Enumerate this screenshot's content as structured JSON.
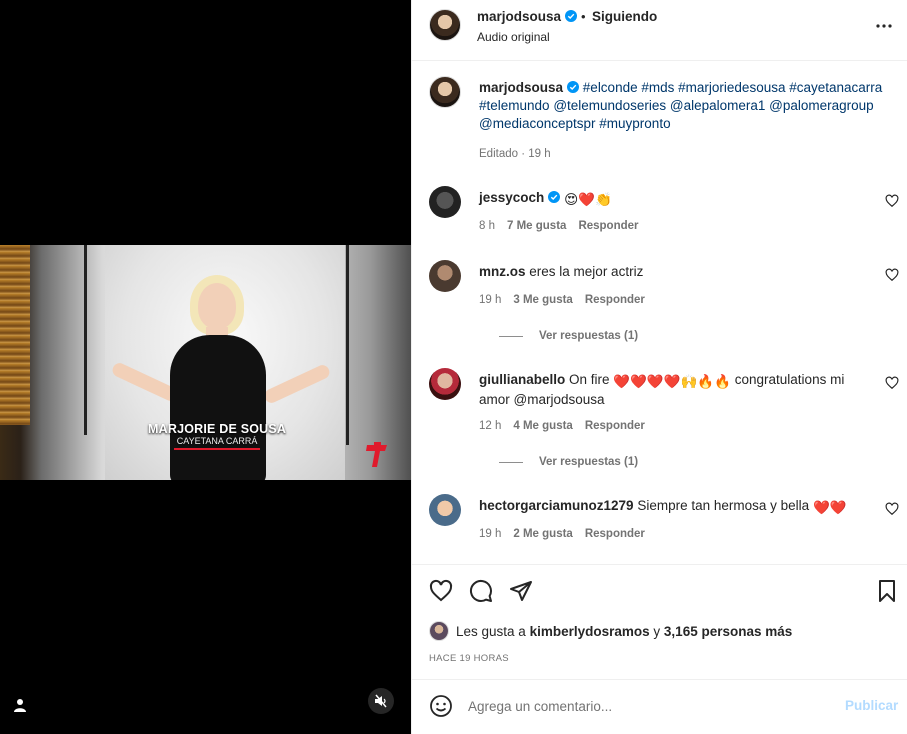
{
  "media": {
    "lower_third_name": "MARJORIE DE SOUSA",
    "lower_third_role": "CAYETANA CARRÁ"
  },
  "header": {
    "username": "marjodsousa",
    "separator": "•",
    "follow_status": "Siguiendo",
    "subtitle": "Audio original"
  },
  "caption": {
    "username": "marjodsousa",
    "tags": [
      "#elconde",
      "#mds",
      "#marjoriedesousa",
      "#cayetanacarra",
      "#telemundo",
      "@telemundoseries",
      "@alepalomera1",
      "@palomeragroup",
      "@mediaconceptspr",
      "#muypronto"
    ],
    "meta": "Editado · 19 h"
  },
  "comments": [
    {
      "username": "jessycoch",
      "text": "",
      "emojis": [
        "😍",
        "❤️",
        "👏"
      ],
      "time": "8 h",
      "likes": "7 Me gusta",
      "reply": "Responder"
    },
    {
      "username": "mnz.os",
      "text": "eres la mejor actriz",
      "time": "19 h",
      "likes": "3 Me gusta",
      "reply": "Responder",
      "view_replies": "Ver respuestas (1)"
    },
    {
      "username": "giullianabello",
      "text": "On fire",
      "text2": "congratulations mi amor @marjodsousa",
      "time": "12 h",
      "likes": "4 Me gusta",
      "reply": "Responder",
      "view_replies": "Ver respuestas (1)"
    },
    {
      "username": "hectorgarciamunoz1279",
      "text": "Siempre tan hermosa y bella",
      "time": "19 h",
      "likes": "2 Me gusta",
      "reply": "Responder"
    }
  ],
  "likes": {
    "prefix": "Les gusta a",
    "user": "kimberlydosramos",
    "conj": "y",
    "others": "3,165 personas más"
  },
  "time_ago": "HACE 19 HORAS",
  "composer": {
    "placeholder": "Agrega un comentario...",
    "post_label": "Publicar"
  },
  "colors": {
    "link": "#00376b",
    "verified": "#0095f6",
    "heart": "#ed4956",
    "muted": "#737373"
  }
}
